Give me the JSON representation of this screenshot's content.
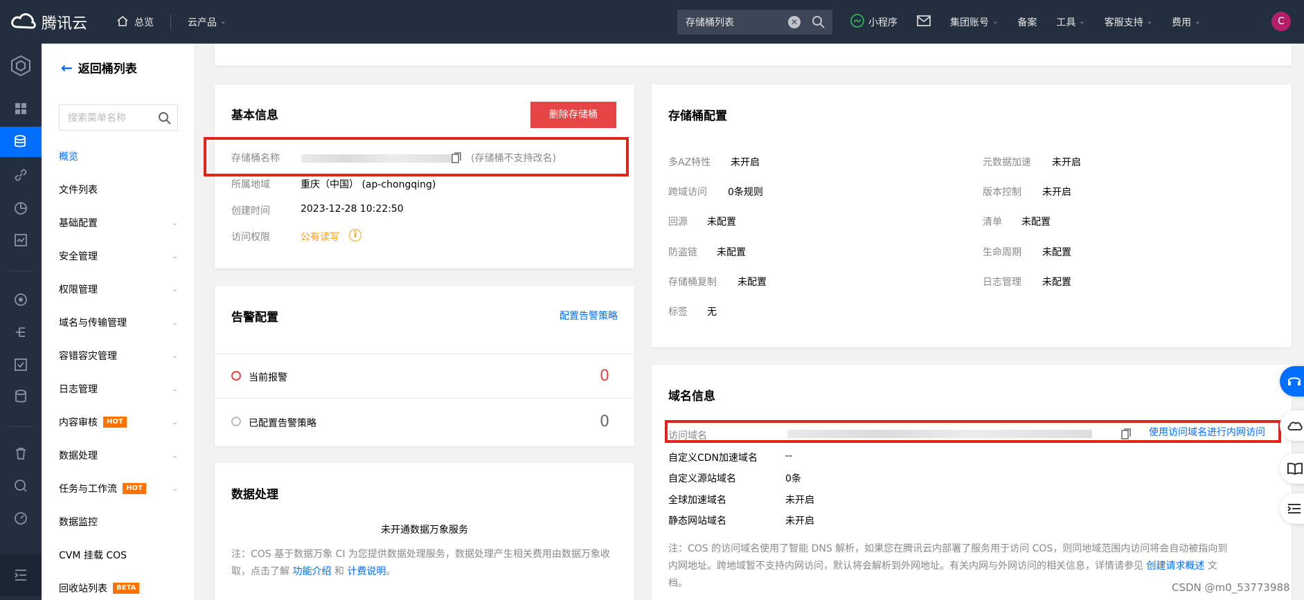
{
  "topbar": {
    "brand": "腾讯云",
    "overview": "总览",
    "products": "云产品",
    "search_value": "存储桶列表",
    "mini_program": "小程序",
    "group_account": "集团账号",
    "filing": "备案",
    "tools": "工具",
    "support": "客服支持",
    "billing": "费用",
    "avatar_letter": "C"
  },
  "sidebar": {
    "back_label": "返回桶列表",
    "search_placeholder": "搜索菜单名称",
    "items": [
      {
        "label": "概览"
      },
      {
        "label": "文件列表"
      },
      {
        "label": "基础配置"
      },
      {
        "label": "安全管理"
      },
      {
        "label": "权限管理"
      },
      {
        "label": "域名与传输管理"
      },
      {
        "label": "容错容灾管理"
      },
      {
        "label": "日志管理"
      },
      {
        "label": "内容审核",
        "badge": "HOT"
      },
      {
        "label": "数据处理"
      },
      {
        "label": "任务与工作流",
        "badge": "HOT"
      },
      {
        "label": "数据监控"
      },
      {
        "label": "CVM 挂载 COS"
      },
      {
        "label": "回收站列表",
        "badge": "BETA"
      }
    ]
  },
  "basic_info": {
    "title": "基本信息",
    "delete_button": "删除存储桶",
    "name_label": "存储桶名称",
    "name_note": "(存储桶不支持改名)",
    "region_label": "所属地域",
    "region_value": "重庆（中国） (ap-chongqing)",
    "created_label": "创建时间",
    "created_value": "2023-12-28 10:22:50",
    "access_label": "访问权限",
    "access_value": "公有读写"
  },
  "alarm": {
    "title": "告警配置",
    "config_link": "配置告警策略",
    "current_label": "当前报警",
    "current_count": "0",
    "configured_label": "已配置告警策略",
    "configured_count": "0"
  },
  "data_processing": {
    "title": "数据处理",
    "status": "未开通数据万象服务",
    "note_prefix": "注：COS 基于数据万象 CI 为您提供数据处理服务，数据处理产生相关费用由数据万象收取，点击了解",
    "link1": "功能介绍",
    "and": "和",
    "link2": "计费说明",
    "note_suffix": "。"
  },
  "bucket_config": {
    "title": "存储桶配置",
    "left": [
      {
        "label": "多AZ特性",
        "value": "未开启"
      },
      {
        "label": "跨域访问",
        "value": "0条规则"
      },
      {
        "label": "回源",
        "value": "未配置"
      },
      {
        "label": "防盗链",
        "value": "未配置"
      },
      {
        "label": "存储桶复制",
        "value": "未配置"
      },
      {
        "label": "标签",
        "value": "无"
      }
    ],
    "right": [
      {
        "label": "元数据加速",
        "value": "未开启"
      },
      {
        "label": "版本控制",
        "value": "未开启"
      },
      {
        "label": "清单",
        "value": "未配置"
      },
      {
        "label": "生命周期",
        "value": "未配置"
      },
      {
        "label": "日志管理",
        "value": "未配置"
      }
    ]
  },
  "domain_info": {
    "title": "域名信息",
    "access_domain_label": "访问域名",
    "intranet_link": "使用访问域名进行内网访问",
    "rows": [
      {
        "label": "自定义CDN加速域名",
        "value": "--"
      },
      {
        "label": "自定义源站域名",
        "value": "0条"
      },
      {
        "label": "全球加速域名",
        "value": "未开启"
      },
      {
        "label": "静态网站域名",
        "value": "未开启"
      }
    ],
    "note_line1": "注：COS 的访问域名使用了智能 DNS 解析，如果您在腾讯云内部署了服务用于访问 COS，则同地域范围内访问将会自动被指向到",
    "note_line2": "内网地址。跨地域暂不支持内网访问，默认将会解析到外网地址。有关内网与外网访问的相关信息，详情请参见",
    "note_link": "创建请求概述",
    "note_line2_end": "文",
    "note_line3": "档。"
  },
  "watermark": "CSDN @m0_53773988"
}
